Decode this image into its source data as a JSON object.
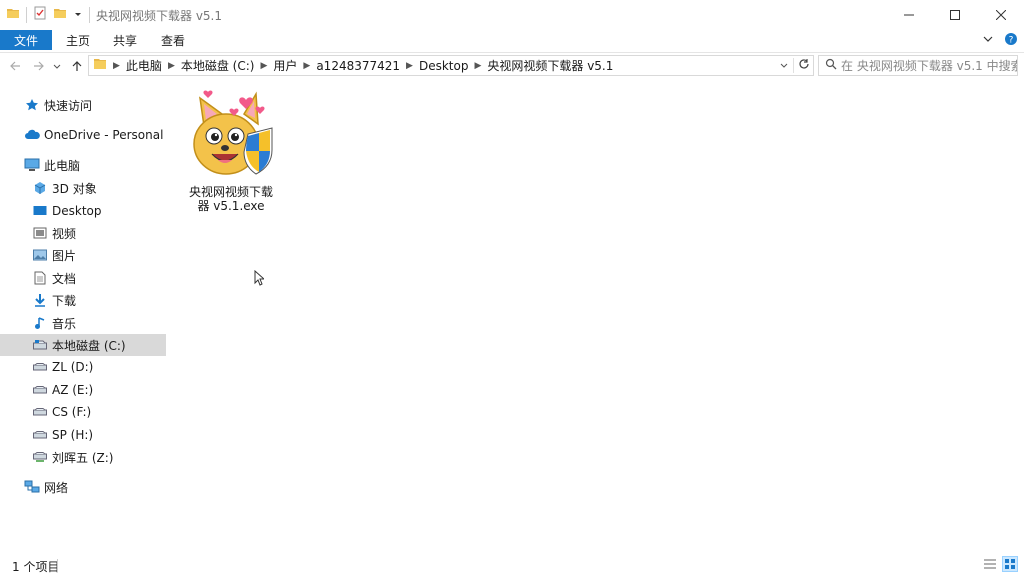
{
  "window": {
    "title": "央视网视频下载器 v5.1"
  },
  "ribbon": {
    "file_tab": "文件",
    "tabs": [
      "主页",
      "共享",
      "查看"
    ]
  },
  "address": {
    "crumbs": [
      "此电脑",
      "本地磁盘 (C:)",
      "用户",
      "a1248377421",
      "Desktop",
      "央视网视频下载器 v5.1"
    ]
  },
  "search": {
    "placeholder": "在 央视网视频下载器 v5.1 中搜索"
  },
  "sidebar": {
    "items": [
      {
        "label": "快速访问",
        "icon": "star-icon"
      },
      {
        "label": "OneDrive - Personal",
        "icon": "cloud-icon"
      },
      {
        "label": "此电脑",
        "icon": "computer-icon"
      },
      {
        "label": "3D 对象",
        "icon": "cube-icon"
      },
      {
        "label": "Desktop",
        "icon": "desktop-icon"
      },
      {
        "label": "视频",
        "icon": "video-icon"
      },
      {
        "label": "图片",
        "icon": "picture-icon"
      },
      {
        "label": "文档",
        "icon": "document-icon"
      },
      {
        "label": "下载",
        "icon": "download-icon"
      },
      {
        "label": "音乐",
        "icon": "music-icon"
      },
      {
        "label": "本地磁盘 (C:)",
        "icon": "drive-c-icon",
        "selected": true
      },
      {
        "label": "ZL (D:)",
        "icon": "drive-icon"
      },
      {
        "label": "AZ (E:)",
        "icon": "drive-icon"
      },
      {
        "label": "CS (F:)",
        "icon": "drive-icon"
      },
      {
        "label": "SP (H:)",
        "icon": "drive-icon"
      },
      {
        "label": "刘晖五 (Z:)",
        "icon": "network-drive-icon"
      },
      {
        "label": "网络",
        "icon": "network-icon"
      }
    ]
  },
  "files": [
    {
      "name": "央视网视频下载器 v5.1.exe",
      "icon": "app-fox-shield-icon"
    }
  ],
  "status": {
    "count": "1 个项目"
  },
  "colors": {
    "accent": "#1979ca",
    "selected_bg": "#d9d9d9"
  }
}
